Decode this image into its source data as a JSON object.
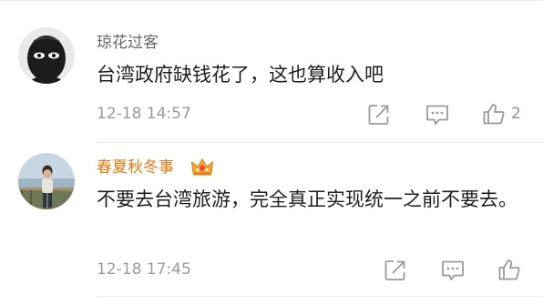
{
  "comments": [
    {
      "username": "琼花过客",
      "avatar_icon": "masked-face-icon",
      "text": "台湾政府缺钱花了，这也算收入吧",
      "time": "12-18 14:57",
      "like_count": "2",
      "name_color": "#666666",
      "actions": [
        "share-icon",
        "comment-icon",
        "like-icon"
      ]
    },
    {
      "username": "春夏秋冬事",
      "avatar_icon": "beach-photo-avatar",
      "badge_icon": "vip-crown-icon",
      "text": "不要去台湾旅游，完全真正实现统一之前不要去。",
      "time": "12-18 17:45",
      "like_count": "",
      "name_color": "#e8790c",
      "actions": [
        "share-icon",
        "comment-icon",
        "like-icon"
      ]
    }
  ],
  "colors": {
    "meta_gray": "#9a9a9a",
    "divider": "#ececec",
    "vip_orange": "#e8790c",
    "crown_gold": "#f6a623"
  }
}
